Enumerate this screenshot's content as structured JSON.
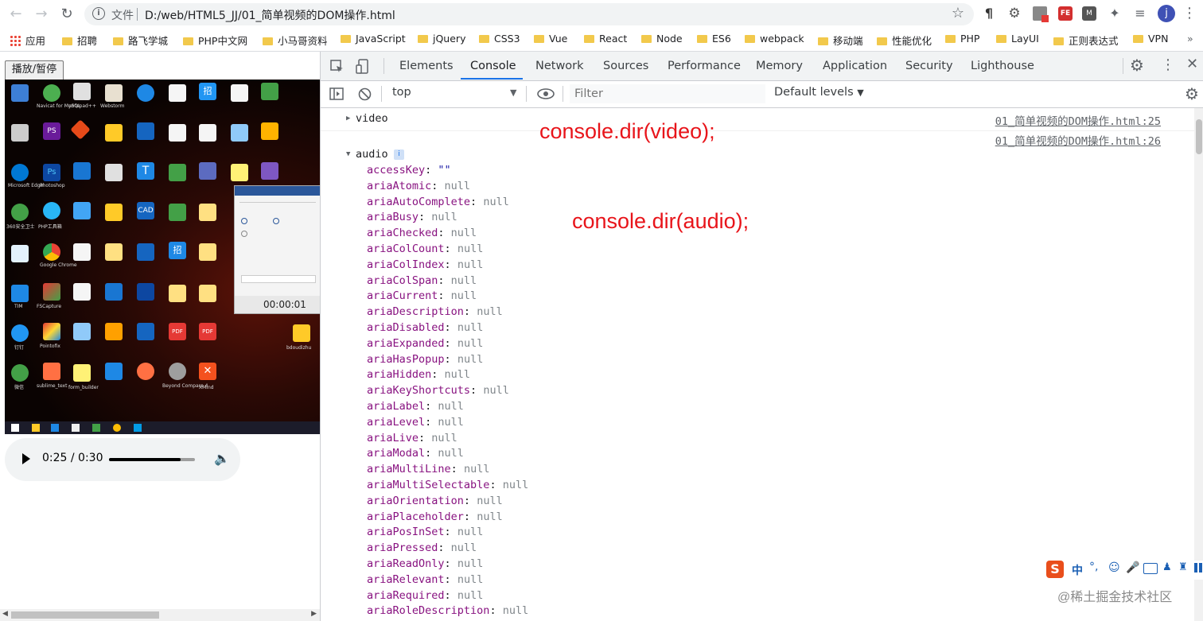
{
  "browser": {
    "address_scheme": "文件",
    "address_url": "D:/web/HTML5_JJ/01_简单视频的DOM操作.html",
    "profile_initial": "j",
    "bookmarks": [
      "应用",
      "招聘",
      "路飞学城",
      "PHP中文网",
      "小马哥资料",
      "JavaScript",
      "jQuery",
      "CSS3",
      "Vue",
      "React",
      "Node",
      "ES6",
      "webpack",
      "移动端",
      "性能优化",
      "PHP",
      "LayUI",
      "正则表达式",
      "VPN"
    ]
  },
  "page": {
    "play_toggle_label": "播放/暂停",
    "recorder_time": "00:00:01",
    "audio_player": {
      "time": "0:25 / 0:30",
      "progress": 0.833
    },
    "desktop_labels": [
      "回收站",
      "Navicat for MySQL",
      "notepad++",
      "Webstorm",
      "Microsoft Edge",
      "Photoshop",
      "360安全卫士",
      "PHP工具箱",
      "Google Chrome",
      "TIM",
      "FSCapture",
      "钉钉",
      "Pointofix",
      "微信",
      "sublime_text",
      "form_builder",
      "Beyond Compare 4",
      "XMind",
      "bdoudizhu"
    ]
  },
  "devtools": {
    "tabs": [
      "Elements",
      "Console",
      "Network",
      "Sources",
      "Performance",
      "Memory",
      "Application",
      "Security",
      "Lighthouse"
    ],
    "active_tab": "Console",
    "context": "top",
    "filter_placeholder": "Filter",
    "levels": "Default levels",
    "logs": [
      {
        "name": "video",
        "expanded": false,
        "source": "01_简单视频的DOM操作.html:25"
      },
      {
        "name": "audio",
        "expanded": true,
        "source": "01_简单视频的DOM操作.html:26"
      }
    ],
    "audio_properties": [
      {
        "key": "accessKey",
        "value": "\"\""
      },
      {
        "key": "ariaAtomic",
        "value": "null"
      },
      {
        "key": "ariaAutoComplete",
        "value": "null"
      },
      {
        "key": "ariaBusy",
        "value": "null"
      },
      {
        "key": "ariaChecked",
        "value": "null"
      },
      {
        "key": "ariaColCount",
        "value": "null"
      },
      {
        "key": "ariaColIndex",
        "value": "null"
      },
      {
        "key": "ariaColSpan",
        "value": "null"
      },
      {
        "key": "ariaCurrent",
        "value": "null"
      },
      {
        "key": "ariaDescription",
        "value": "null"
      },
      {
        "key": "ariaDisabled",
        "value": "null"
      },
      {
        "key": "ariaExpanded",
        "value": "null"
      },
      {
        "key": "ariaHasPopup",
        "value": "null"
      },
      {
        "key": "ariaHidden",
        "value": "null"
      },
      {
        "key": "ariaKeyShortcuts",
        "value": "null"
      },
      {
        "key": "ariaLabel",
        "value": "null"
      },
      {
        "key": "ariaLevel",
        "value": "null"
      },
      {
        "key": "ariaLive",
        "value": "null"
      },
      {
        "key": "ariaModal",
        "value": "null"
      },
      {
        "key": "ariaMultiLine",
        "value": "null"
      },
      {
        "key": "ariaMultiSelectable",
        "value": "null"
      },
      {
        "key": "ariaOrientation",
        "value": "null"
      },
      {
        "key": "ariaPlaceholder",
        "value": "null"
      },
      {
        "key": "ariaPosInSet",
        "value": "null"
      },
      {
        "key": "ariaPressed",
        "value": "null"
      },
      {
        "key": "ariaReadOnly",
        "value": "null"
      },
      {
        "key": "ariaRelevant",
        "value": "null"
      },
      {
        "key": "ariaRequired",
        "value": "null"
      },
      {
        "key": "ariaRoleDescription",
        "value": "null"
      }
    ],
    "annotations": [
      "console.dir(video);",
      "console.dir(audio);"
    ],
    "annotation_color": "#e8141a"
  },
  "watermark": "@稀土掘金技术社区",
  "ime_label": "中"
}
